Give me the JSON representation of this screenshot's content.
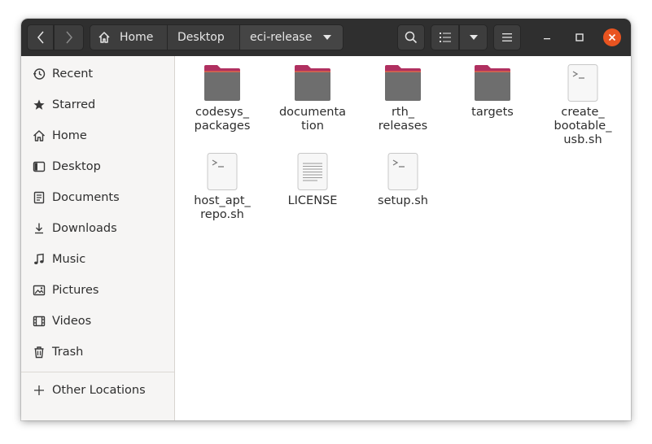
{
  "header": {
    "breadcrumbs": [
      "Home",
      "Desktop",
      "eci-release"
    ]
  },
  "sidebar": {
    "items": [
      {
        "label": "Recent",
        "icon": "clock-icon"
      },
      {
        "label": "Starred",
        "icon": "star-icon"
      },
      {
        "label": "Home",
        "icon": "home-icon"
      },
      {
        "label": "Desktop",
        "icon": "desktop-icon"
      },
      {
        "label": "Documents",
        "icon": "document-icon"
      },
      {
        "label": "Downloads",
        "icon": "download-icon"
      },
      {
        "label": "Music",
        "icon": "music-icon"
      },
      {
        "label": "Pictures",
        "icon": "picture-icon"
      },
      {
        "label": "Videos",
        "icon": "video-icon"
      },
      {
        "label": "Trash",
        "icon": "trash-icon"
      }
    ],
    "other_locations": "Other Locations"
  },
  "files": [
    {
      "name": "codesys_\npackages",
      "type": "folder"
    },
    {
      "name": "documenta\ntion",
      "type": "folder"
    },
    {
      "name": "rth_\nreleases",
      "type": "folder"
    },
    {
      "name": "targets",
      "type": "folder"
    },
    {
      "name": "create_\nbootable_\nusb.sh",
      "type": "script"
    },
    {
      "name": "host_apt_\nrepo.sh",
      "type": "script"
    },
    {
      "name": "LICENSE",
      "type": "text"
    },
    {
      "name": "setup.sh",
      "type": "script"
    }
  ],
  "colors": {
    "folder_tab": "#b03060",
    "folder_body": "#6e6e6e",
    "close_button": "#e95420",
    "headerbar": "#2f2f2f"
  }
}
